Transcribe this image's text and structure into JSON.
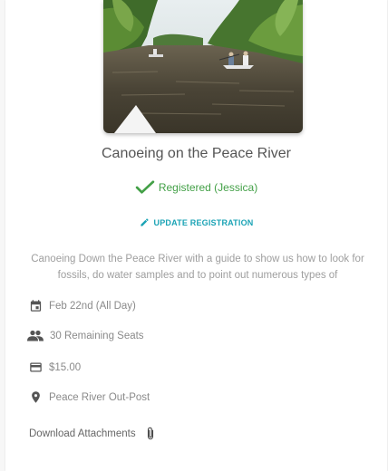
{
  "event": {
    "title": "Canoeing on the Peace River",
    "registration_status": "Registered (Jessica)",
    "update_label": "UPDATE REGISTRATION",
    "description": "Canoeing Down the Peace River with a guide to show us how to look for fossils, do water samples and to point out numerous types of",
    "date": "Feb 22nd (All Day)",
    "seats": "30 Remaining Seats",
    "price": "$15.00",
    "location": "Peace River Out-Post",
    "attachments_label": "Download Attachments"
  },
  "icons": {
    "registered": "check-icon",
    "update": "pencil-icon",
    "date": "calendar-icon",
    "seats": "people-icon",
    "price": "credit-card-icon",
    "location": "location-pin-icon",
    "attachments": "paperclip-icon"
  },
  "colors": {
    "registered": "#43a047",
    "accent": "#1aa3b5"
  }
}
